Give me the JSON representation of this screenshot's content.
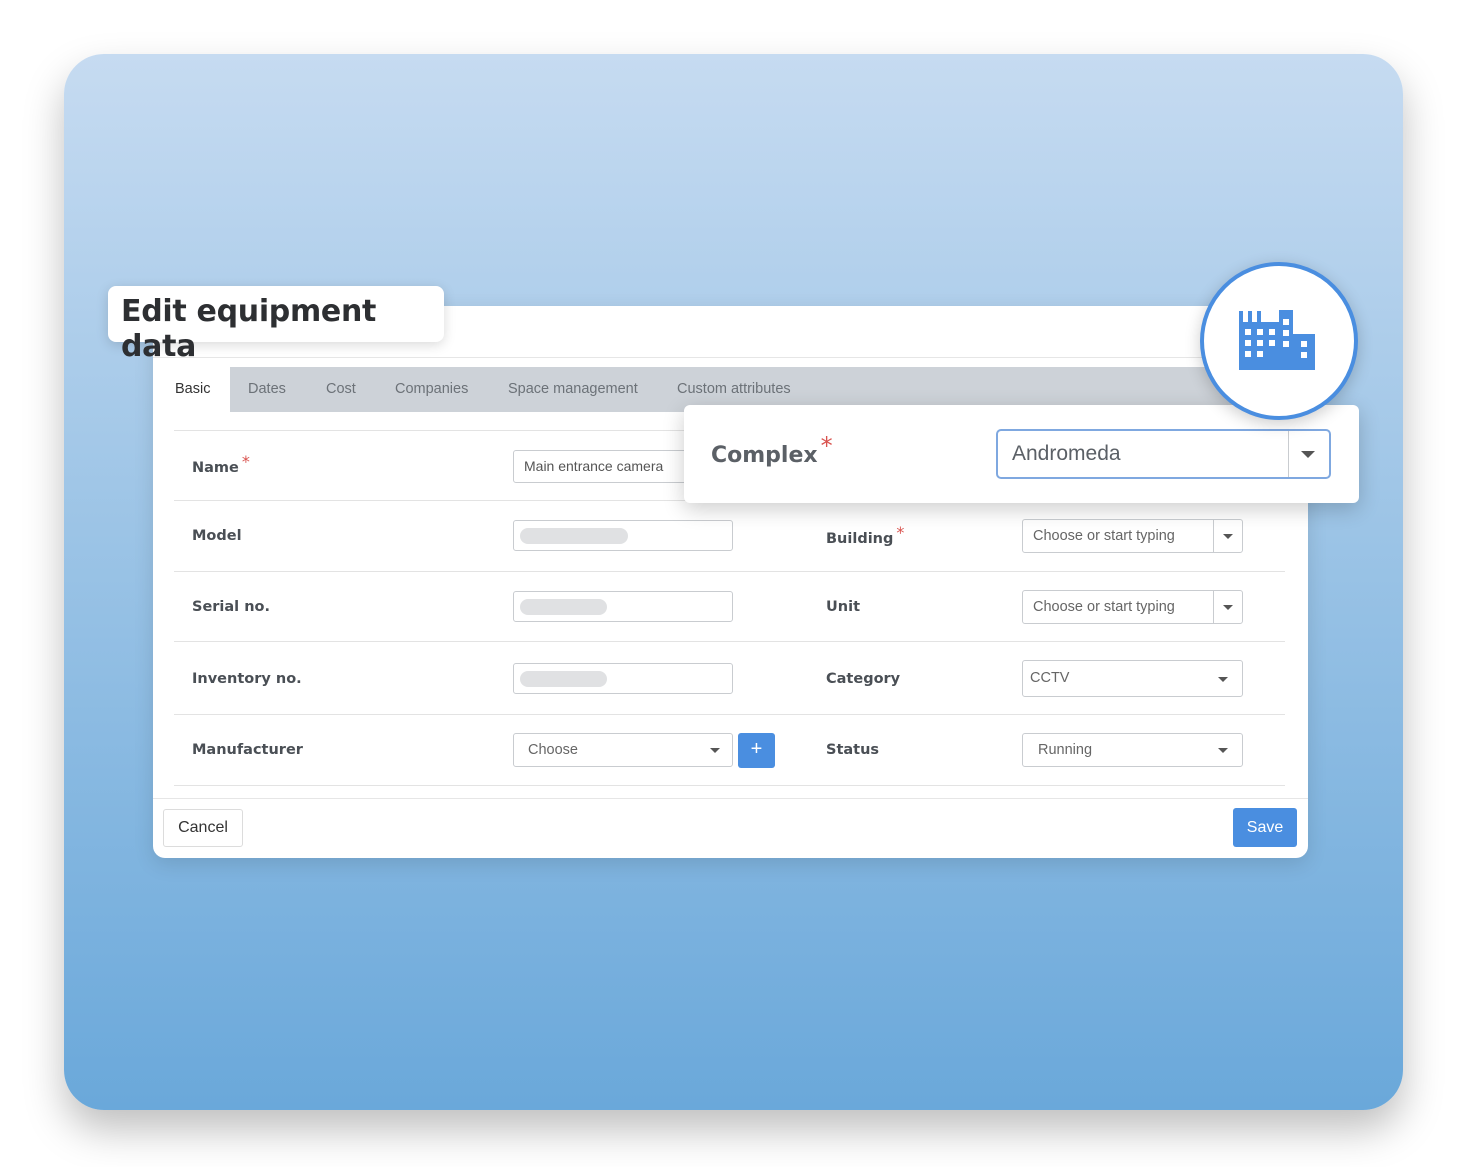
{
  "title": "Edit equipment data",
  "tabs": [
    {
      "label": "Basic",
      "active": true
    },
    {
      "label": "Dates",
      "active": false
    },
    {
      "label": "Cost",
      "active": false
    },
    {
      "label": "Companies",
      "active": false
    },
    {
      "label": "Space management",
      "active": false
    },
    {
      "label": "Custom attributes",
      "active": false
    }
  ],
  "form": {
    "name": {
      "label": "Name",
      "required_mark": "*",
      "value": "Main entrance camera"
    },
    "model": {
      "label": "Model",
      "value": ""
    },
    "serial": {
      "label": "Serial no.",
      "value": ""
    },
    "inventory": {
      "label": "Inventory no.",
      "value": ""
    },
    "manufacturer": {
      "label": "Manufacturer",
      "value": "Choose",
      "add_label": "+"
    },
    "building": {
      "label": "Building",
      "required_mark": "*",
      "placeholder": "Choose or start typing"
    },
    "unit": {
      "label": "Unit",
      "placeholder": "Choose or start typing"
    },
    "category": {
      "label": "Category",
      "value": "CCTV"
    },
    "status": {
      "label": "Status",
      "value": "Running"
    }
  },
  "popup": {
    "label": "Complex",
    "required_mark": "*",
    "value": "Andromeda"
  },
  "footer": {
    "cancel_label": "Cancel",
    "save_label": "Save"
  },
  "icon": "building-icon",
  "colors": {
    "accent": "#4a8ee0",
    "required": "#d9534f",
    "tabbar": "#cdd2d8"
  }
}
